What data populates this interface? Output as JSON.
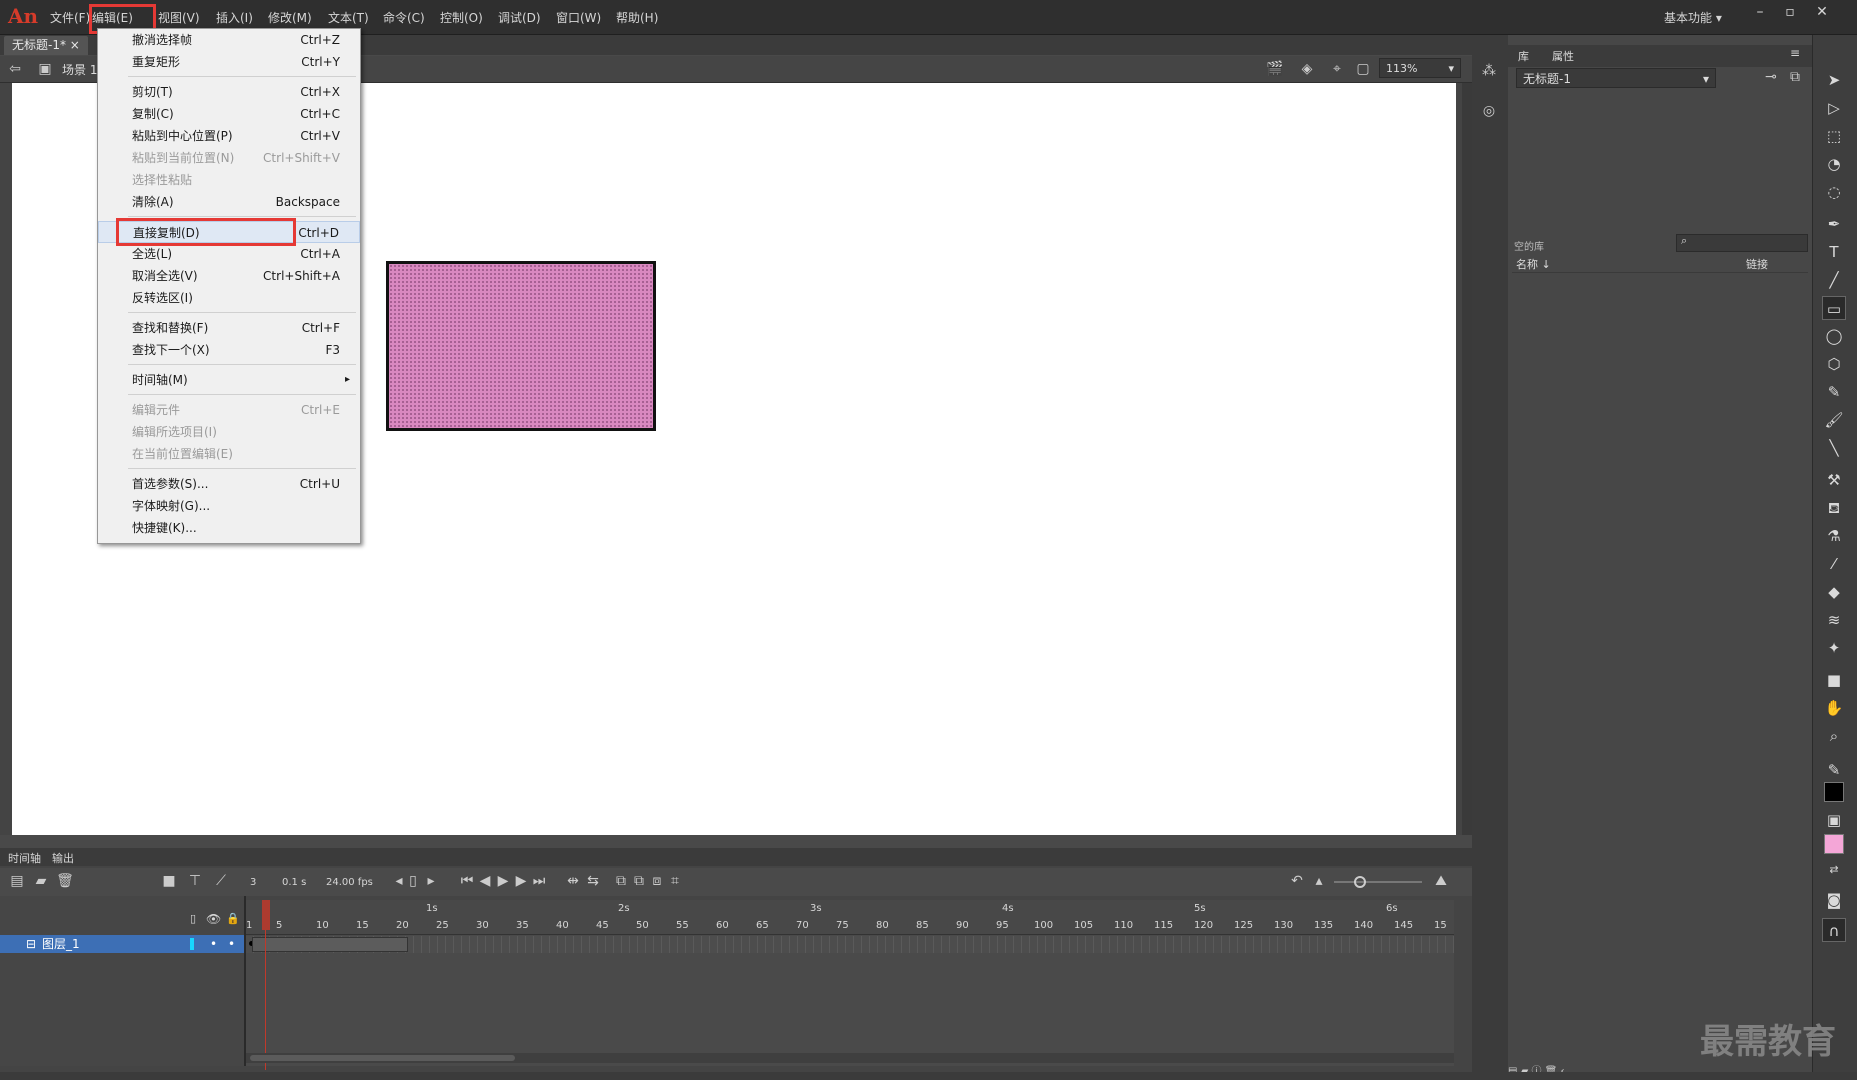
{
  "app": {
    "logo": "An",
    "workspace": "基本功能",
    "min": "–",
    "max": "▫",
    "close": "✕"
  },
  "menubar": [
    "文件(F)",
    "编辑(E)",
    "视图(V)",
    "插入(I)",
    "修改(M)",
    "文本(T)",
    "命令(C)",
    "控制(O)",
    "调试(D)",
    "窗口(W)",
    "帮助(H)"
  ],
  "document": {
    "tab": "无标题-1*",
    "tab_close": "×",
    "scene": "场景 1",
    "zoom": "113%"
  },
  "edit_menu": {
    "items": [
      {
        "label": "撤消选择帧",
        "shortcut": "Ctrl+Z",
        "disabled": false
      },
      {
        "label": "重复矩形",
        "shortcut": "Ctrl+Y",
        "disabled": false
      },
      {
        "label": "剪切(T)",
        "shortcut": "Ctrl+X",
        "disabled": false
      },
      {
        "label": "复制(C)",
        "shortcut": "Ctrl+C",
        "disabled": false
      },
      {
        "label": "粘贴到中心位置(P)",
        "shortcut": "Ctrl+V",
        "disabled": false
      },
      {
        "label": "粘贴到当前位置(N)",
        "shortcut": "Ctrl+Shift+V",
        "disabled": true
      },
      {
        "label": "选择性粘贴",
        "shortcut": "",
        "disabled": true
      },
      {
        "label": "清除(A)",
        "shortcut": "Backspace",
        "disabled": false
      },
      {
        "label": "直接复制(D)",
        "shortcut": "Ctrl+D",
        "disabled": false
      },
      {
        "label": "全选(L)",
        "shortcut": "Ctrl+A",
        "disabled": false
      },
      {
        "label": "取消全选(V)",
        "shortcut": "Ctrl+Shift+A",
        "disabled": false
      },
      {
        "label": "反转选区(I)",
        "shortcut": "",
        "disabled": false
      },
      {
        "label": "查找和替换(F)",
        "shortcut": "Ctrl+F",
        "disabled": false
      },
      {
        "label": "查找下一个(X)",
        "shortcut": "F3",
        "disabled": false
      },
      {
        "label": "时间轴(M)",
        "shortcut": "",
        "disabled": false
      },
      {
        "label": "编辑元件",
        "shortcut": "Ctrl+E",
        "disabled": true
      },
      {
        "label": "编辑所选项目(I)",
        "shortcut": "",
        "disabled": true
      },
      {
        "label": "在当前位置编辑(E)",
        "shortcut": "",
        "disabled": true
      },
      {
        "label": "首选参数(S)...",
        "shortcut": "Ctrl+U",
        "disabled": false
      },
      {
        "label": "字体映射(G)...",
        "shortcut": "",
        "disabled": false
      },
      {
        "label": "快捷键(K)...",
        "shortcut": "",
        "disabled": false
      }
    ],
    "submenu_arrow": "▸"
  },
  "timeline": {
    "tabs": [
      "时间轴",
      "输出"
    ],
    "current_frame": "3",
    "elapsed": "0.1 s",
    "fps": "24.00 fps",
    "layer": "图层_1",
    "frame_numbers": [
      "1",
      "5",
      "10",
      "15",
      "20",
      "25",
      "30",
      "35",
      "40",
      "45",
      "50",
      "55",
      "60",
      "65",
      "70",
      "75",
      "80",
      "85",
      "90",
      "95",
      "100",
      "105",
      "110",
      "115",
      "120",
      "125",
      "130",
      "135",
      "140",
      "145",
      "15"
    ],
    "seconds": [
      "1s",
      "2s",
      "3s",
      "4s",
      "5s",
      "6s"
    ]
  },
  "library": {
    "tabs": [
      "库",
      "属性"
    ],
    "document": "无标题-1",
    "count": "空的库",
    "col_name": "名称 ↓",
    "col_link": "链接"
  },
  "colors": {
    "accent_highlight": "#e53935",
    "fill": "#f4a6d7",
    "stroke": "#000000"
  },
  "watermark": "最需教育"
}
